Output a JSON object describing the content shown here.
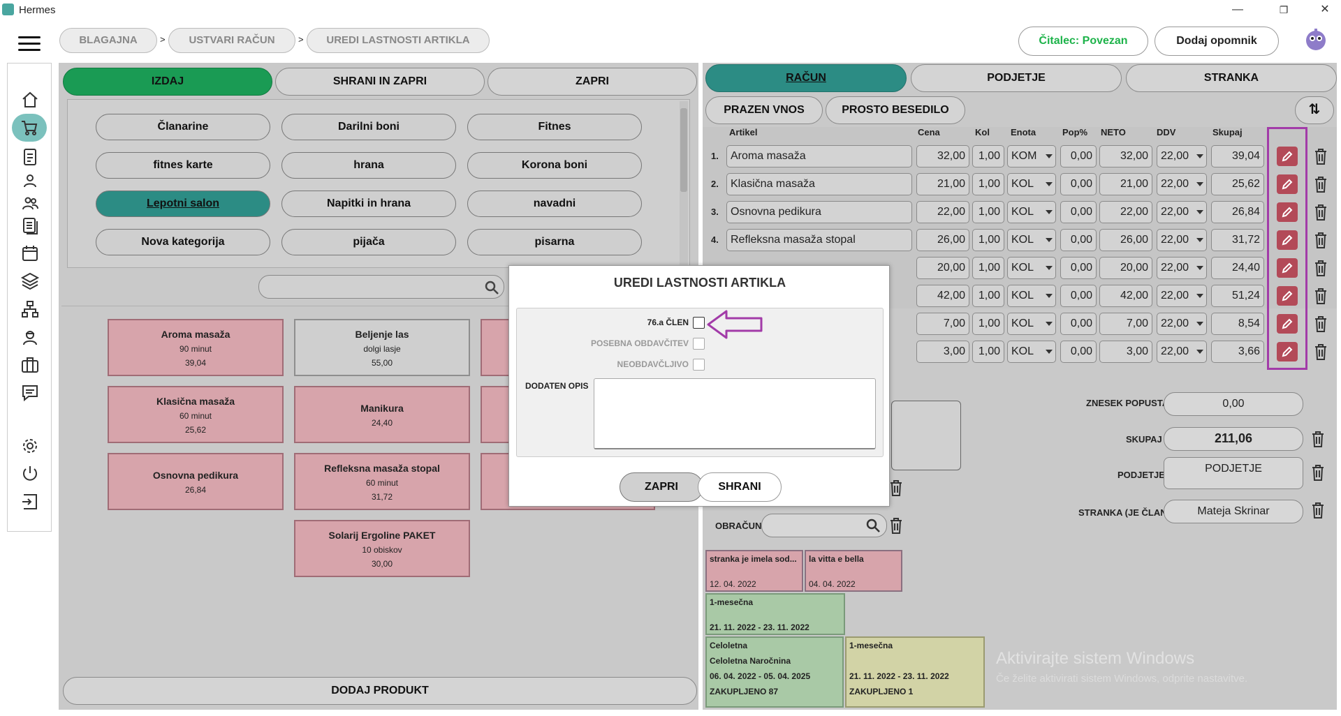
{
  "window": {
    "title": "Hermes",
    "minimize": "—",
    "restore": "❐",
    "close": "✕"
  },
  "breadcrumb": {
    "items": [
      "BLAGAJNA",
      "USTVARI RAČUN",
      "UREDI LASTNOSTI ARTIKLA"
    ],
    "sep": ">"
  },
  "header": {
    "reader_status": "Čitalec: Povezan",
    "reader_color": "#1db34a",
    "reminder_btn": "Dodaj opomnik"
  },
  "sidebar": {
    "icons": [
      "home-icon",
      "cart-icon",
      "document-icon",
      "person-icon",
      "people-icon",
      "list-icon",
      "calendar-icon",
      "layers-icon",
      "network-icon",
      "worker-icon",
      "briefcase-icon",
      "chat-icon",
      "gear-icon",
      "power-icon",
      "exit-icon"
    ]
  },
  "left": {
    "tabs": [
      "IZDAJ",
      "SHRANI IN ZAPRI",
      "ZAPRI"
    ],
    "categories": [
      "Članarine",
      "Darilni boni",
      "Fitnes",
      "fitnes karte",
      "hrana",
      "Korona boni",
      "Lepotni salon",
      "Napitki in hrana",
      "navadni",
      "Nova kategorija",
      "pijača",
      "pisarna"
    ],
    "selected_category": "Lepotni salon",
    "products": [
      {
        "name": "Aroma masaža",
        "sub": "90 minut",
        "price": "39,04"
      },
      {
        "name": "Beljenje las",
        "sub": "dolgi lasje",
        "price": "55,00"
      },
      {
        "name": "Klasična masaža",
        "sub": "60 minut",
        "price": "25,62"
      },
      {
        "name": "Manikura",
        "sub": "",
        "price": "24,40"
      },
      {
        "name": "Osnovna pedikura",
        "sub": "",
        "price": "26,84"
      },
      {
        "name": "Refleksna masaža stopal",
        "sub": "60 minut",
        "price": "31,72"
      },
      {
        "name": "Solarij Ergoline PAKET",
        "sub": "10 obiskov",
        "price": "30,00"
      }
    ],
    "add_product": "DODAJ PRODUKT"
  },
  "right": {
    "tabs": [
      "RAČUN",
      "PODJETJE",
      "STRANKA"
    ],
    "sub_tabs": [
      "PRAZEN VNOS",
      "PROSTO BESEDILO"
    ],
    "columns": [
      "Artikel",
      "Cena",
      "Kol",
      "Enota",
      "Pop%",
      "NETO",
      "DDV",
      "Skupaj"
    ],
    "rows": [
      {
        "n": "1.",
        "artikel": "Aroma masaža",
        "cena": "32,00",
        "kol": "1,00",
        "enota": "KOM",
        "pop": "0,00",
        "neto": "32,00",
        "ddv": "22,00",
        "skupaj": "39,04"
      },
      {
        "n": "2.",
        "artikel": "Klasična masaža",
        "cena": "21,00",
        "kol": "1,00",
        "enota": "KOL",
        "pop": "0,00",
        "neto": "21,00",
        "ddv": "22,00",
        "skupaj": "25,62"
      },
      {
        "n": "3.",
        "artikel": "Osnovna pedikura",
        "cena": "22,00",
        "kol": "1,00",
        "enota": "KOL",
        "pop": "0,00",
        "neto": "22,00",
        "ddv": "22,00",
        "skupaj": "26,84"
      },
      {
        "n": "4.",
        "artikel": "Refleksna masaža stopal",
        "cena": "26,00",
        "kol": "1,00",
        "enota": "KOL",
        "pop": "0,00",
        "neto": "26,00",
        "ddv": "22,00",
        "skupaj": "31,72"
      },
      {
        "n": "",
        "artikel": "",
        "cena": "20,00",
        "kol": "1,00",
        "enota": "KOL",
        "pop": "0,00",
        "neto": "20,00",
        "ddv": "22,00",
        "skupaj": "24,40"
      },
      {
        "n": "",
        "artikel": "",
        "cena": "42,00",
        "kol": "1,00",
        "enota": "KOL",
        "pop": "0,00",
        "neto": "42,00",
        "ddv": "22,00",
        "skupaj": "51,24"
      },
      {
        "n": "",
        "artikel": "",
        "cena": "7,00",
        "kol": "1,00",
        "enota": "KOL",
        "pop": "0,00",
        "neto": "7,00",
        "ddv": "22,00",
        "skupaj": "8,54"
      },
      {
        "n": "",
        "artikel": "",
        "cena": "3,00",
        "kol": "1,00",
        "enota": "KOL",
        "pop": "0,00",
        "neto": "3,00",
        "ddv": "22,00",
        "skupaj": "3,66"
      }
    ],
    "discount_label": "ZNESEK POPUSTA",
    "discount_value": "0,00",
    "total_label": "SKUPAJ",
    "total_value": "211,06",
    "company_label": "PODJETJE",
    "company_value": "PODJETJE",
    "customer_label": "STRANKA (JE ČLAN)",
    "customer_value": "Mateja Skrinar",
    "obracun_label": "OBRAČUN",
    "history": [
      {
        "title": "stranka je imela sod...",
        "date": "12. 04. 2022"
      },
      {
        "title": "la vitta e bella",
        "date": "04. 04. 2022"
      },
      {
        "title": "1-mesečna",
        "date": "21. 11. 2022 - 23. 11. 2022"
      },
      {
        "title": "Celoletna",
        "line2": "Celoletna Naročnina",
        "date": "06. 04. 2022 - 05. 04. 2025",
        "extra": "ZAKUPLJENO 87"
      },
      {
        "title": "1-mesečna",
        "date": "21. 11. 2022 - 23. 11. 2022",
        "extra": "ZAKUPLJENO 1"
      }
    ],
    "watermark_title": "Aktivirajte sistem Windows",
    "watermark_sub": "Če želite aktivirati sistem Windows, odprite nastavitve."
  },
  "modal": {
    "title": "UREDI LASTNOSTI ARTIKLA",
    "opt1": "76.a ČLEN",
    "opt2": "POSEBNA OBDAVČITEV",
    "opt3": "NEOBDAVČLJIVO",
    "desc_label": "DODATEN OPIS",
    "desc_value": "",
    "close_btn": "ZAPRI",
    "save_btn": "SHRANI"
  },
  "colors": {
    "highlight": "#a23ba8",
    "edit": "#b34a58",
    "teal": "#2c8c84",
    "green": "#1a9b54"
  }
}
